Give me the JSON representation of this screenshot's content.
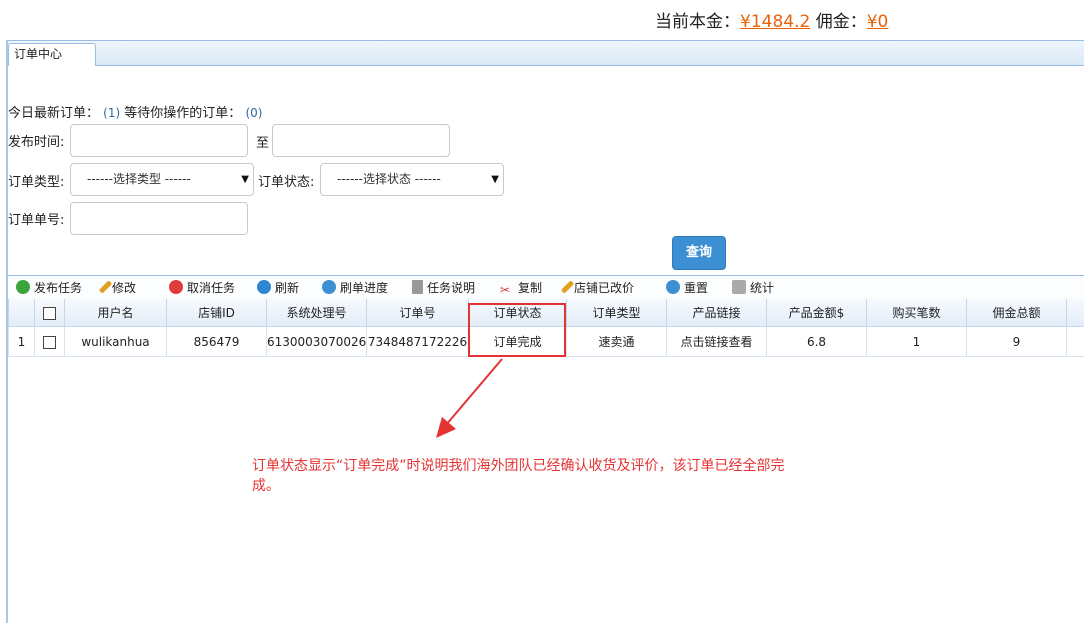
{
  "balance": {
    "principal_label": "当前本金：",
    "principal_value": "¥1484.2",
    "commission_label": "佣金：",
    "commission_value": "¥0"
  },
  "tab": {
    "label": "订单中心"
  },
  "summary": {
    "today_label": "今日最新订单：",
    "today_count": "(1)",
    "waiting_label": "等待你操作的订单：",
    "waiting_count": "(0)"
  },
  "filters": {
    "publish_time_label": "发布时间:",
    "to_label": "至",
    "order_type_label": "订单类型:",
    "order_type_value": "------选择类型 ------",
    "order_status_label": "订单状态:",
    "order_status_value": "------选择状态 ------",
    "order_no_label": "订单单号:",
    "query_label": "查询"
  },
  "toolbar": [
    {
      "label": "发布任务",
      "icon": "add-icon",
      "color": "#3aa53a"
    },
    {
      "label": "修改",
      "icon": "pencil-icon",
      "color": "#e0a020"
    },
    {
      "label": "取消任务",
      "icon": "cancel-icon",
      "color": "#e03a3a"
    },
    {
      "label": "刷新",
      "icon": "refresh-icon",
      "color": "#2e86d0"
    },
    {
      "label": "刷单进度",
      "icon": "globe-icon",
      "color": "#3b8fd2"
    },
    {
      "label": "任务说明",
      "icon": "document-icon",
      "color": "#777777"
    },
    {
      "label": "复制",
      "icon": "scissors-icon",
      "color": "#d04040"
    },
    {
      "label": "店铺已改价",
      "icon": "pencil-icon",
      "color": "#e0a020"
    },
    {
      "label": "重置",
      "icon": "globe-icon",
      "color": "#3b8fd2"
    },
    {
      "label": "统计",
      "icon": "chart-icon",
      "color": "#888888"
    }
  ],
  "grid": {
    "columns": [
      "用户名",
      "店铺ID",
      "系统处理号",
      "订单号",
      "订单状态",
      "订单类型",
      "产品链接",
      "产品金额$",
      "购买笔数",
      "佣金总额"
    ],
    "rows": [
      {
        "index": "1",
        "username": "wulikanhua",
        "shop_id": "856479",
        "system_no": "6130003070026",
        "order_no": "7348487172226",
        "status": "订单完成",
        "type": "速卖通",
        "link": "点击链接查看",
        "amount": "6.8",
        "count": "1",
        "commission": "9"
      }
    ]
  },
  "annotation": {
    "note": "订单状态显示“订单完成”时说明我们海外团队已经确认收货及评价，该订单已经全部完成。"
  }
}
